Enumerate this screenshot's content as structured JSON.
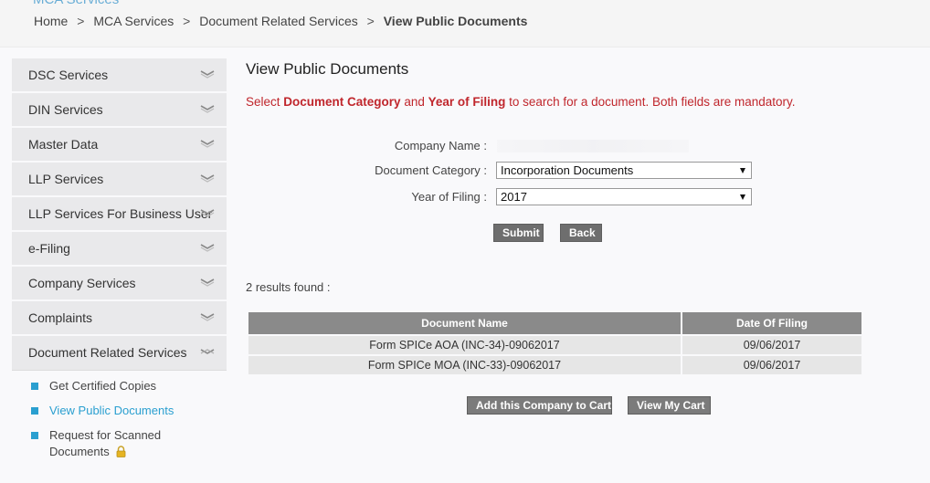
{
  "header": {
    "section_title": "MCA Services",
    "breadcrumb": [
      "Home",
      "MCA Services",
      "Document Related Services",
      "View Public Documents"
    ],
    "breadcrumb_separator": ">"
  },
  "sidebar": {
    "items": [
      {
        "label": "DSC Services"
      },
      {
        "label": "DIN Services"
      },
      {
        "label": "Master Data"
      },
      {
        "label": "LLP Services"
      },
      {
        "label": "LLP Services For Business User"
      },
      {
        "label": "e-Filing"
      },
      {
        "label": "Company Services"
      },
      {
        "label": "Complaints"
      },
      {
        "label": "Document Related Services",
        "expanded": true
      }
    ],
    "submenu": [
      {
        "label": "Get Certified Copies"
      },
      {
        "label": "View Public Documents",
        "active": true
      },
      {
        "label": "Request for Scanned Documents",
        "locked": true
      }
    ]
  },
  "main": {
    "title": "View Public Documents",
    "instruction": {
      "prefix": "Select ",
      "field1": "Document Category",
      "middle": " and ",
      "field2": "Year of Filing",
      "suffix": " to search for a document. Both fields are mandatory."
    },
    "form": {
      "company_name_label": "Company Name :",
      "company_name_value": "",
      "document_category_label": "Document Category :",
      "document_category_selected": "Incorporation Documents",
      "year_label": "Year of Filing :",
      "year_selected": "2017",
      "submit_label": "Submit",
      "back_label": "Back"
    },
    "results_text": "2  results found :",
    "table": {
      "headers": [
        "Document Name",
        "Date Of Filing"
      ],
      "rows": [
        [
          "Form SPICe AOA (INC-34)-09062017",
          "09/06/2017"
        ],
        [
          "Form SPICe MOA (INC-33)-09062017",
          "09/06/2017"
        ]
      ]
    },
    "add_to_cart_label": "Add this Company to Cart",
    "view_cart_label": "View My Cart"
  },
  "colors": {
    "accent_blue": "#2a9fd0",
    "instruction_red": "#c0262c",
    "button_gray": "#6e6e6e",
    "table_header_gray": "#8a8a8a"
  }
}
